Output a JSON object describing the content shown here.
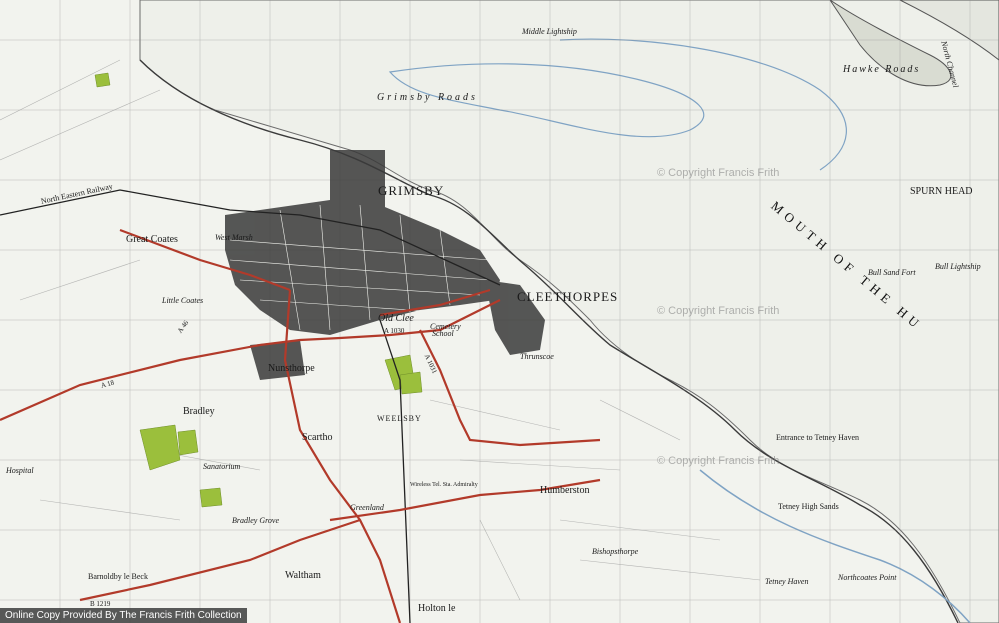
{
  "map": {
    "places": [
      {
        "key": "grimsby",
        "text": "GRIMSBY"
      },
      {
        "key": "cleethorpes",
        "text": "CLEETHORPES"
      },
      {
        "key": "grimsby_roads",
        "text": "Grimsby Roads"
      },
      {
        "key": "hawke_roads",
        "text": "Hawke Roads"
      },
      {
        "key": "north_channel",
        "text": "North Channel"
      },
      {
        "key": "spurn_head",
        "text": "SPURN HEAD"
      },
      {
        "key": "bull_sand_fort",
        "text": "Bull Sand Fort"
      },
      {
        "key": "bull_lightship",
        "text": "Bull Lightship"
      },
      {
        "key": "middle_lightship",
        "text": "Middle Lightship"
      },
      {
        "key": "great_coates",
        "text": "Great Coates"
      },
      {
        "key": "west_marsh",
        "text": "West Marsh"
      },
      {
        "key": "little_coates",
        "text": "Little Coates"
      },
      {
        "key": "old_clee",
        "text": "Old Clee"
      },
      {
        "key": "nunsthorpe",
        "text": "Nunsthorpe"
      },
      {
        "key": "bradley",
        "text": "Bradley"
      },
      {
        "key": "scartho",
        "text": "Scartho"
      },
      {
        "key": "weelsby",
        "text": "WEELSBY"
      },
      {
        "key": "thrunscoe",
        "text": "Thrunscoe"
      },
      {
        "key": "humberston",
        "text": "Humberston"
      },
      {
        "key": "waltham",
        "text": "Waltham"
      },
      {
        "key": "holton_le_clay",
        "text": "Holton le"
      },
      {
        "key": "barnoldby",
        "text": "Barnoldby le Beck"
      },
      {
        "key": "greenland",
        "text": "Greenland"
      },
      {
        "key": "tetney_high_sands",
        "text": "Tetney High Sands"
      },
      {
        "key": "entrance_tetney",
        "text": "Entrance to Tetney Haven"
      },
      {
        "key": "north_eastern_railway",
        "text": "North Eastern Railway"
      },
      {
        "key": "bradley_grove",
        "text": "Bradley Grove"
      },
      {
        "key": "wireless",
        "text": "Wireless Tel. Sta. Admiralty"
      },
      {
        "key": "cemetery",
        "text": "Cemetery"
      },
      {
        "key": "school",
        "text": "School"
      },
      {
        "key": "sanatorium",
        "text": "Sanatorium"
      },
      {
        "key": "hospital",
        "text": "Hospital"
      },
      {
        "key": "bishopsthorpe",
        "text": "Bishopsthorpe"
      },
      {
        "key": "northcoates_point",
        "text": "Northcoates Point"
      },
      {
        "key": "tetney_haven",
        "text": "Tetney Haven"
      }
    ],
    "roads": [
      {
        "key": "a1030",
        "text": "A 1030"
      },
      {
        "key": "a1031",
        "text": "A 1031"
      },
      {
        "key": "a18",
        "text": "A 18"
      },
      {
        "key": "a46",
        "text": "A 46"
      },
      {
        "key": "b1219",
        "text": "B 1219"
      }
    ],
    "sea_label": "MOUTH OF THE HU",
    "watermarks": [
      "© Copyright Francis Frith",
      "© Copyright Francis Frith",
      "© Copyright Francis Frith"
    ],
    "copyright": "Online Copy Provided By The Francis Frith Collection",
    "colors": {
      "paper": "#f2f3ee",
      "water": "#7fa3c4",
      "urban": "#3a3a3a",
      "road_red": "#b23a2a",
      "woodland": "#9bbf3c",
      "grid": "#8a8a8a"
    }
  }
}
